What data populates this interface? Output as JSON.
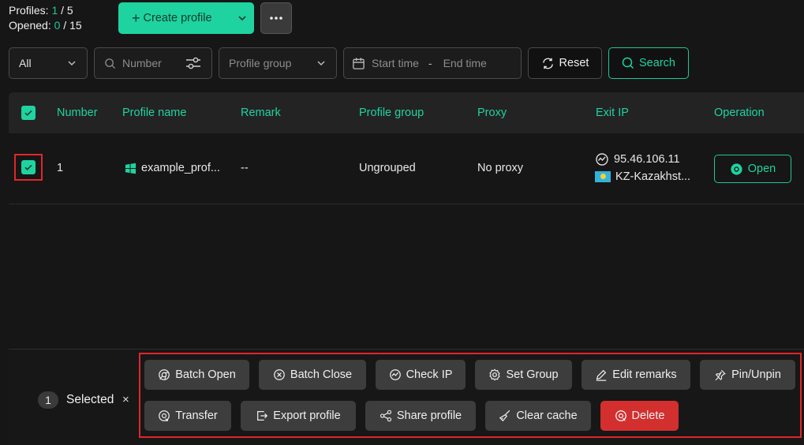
{
  "header": {
    "profiles_label": "Profiles:",
    "profiles_current": "1",
    "profiles_total": "/ 5",
    "opened_label": "Opened:",
    "opened_current": "0",
    "opened_total": "/ 15",
    "create_label": "Create profile"
  },
  "filters": {
    "all_value": "All",
    "number_placeholder": "Number",
    "group_placeholder": "Profile group",
    "start_time_placeholder": "Start time",
    "time_separator": "-",
    "end_time_placeholder": "End time",
    "reset_label": "Reset",
    "search_label": "Search"
  },
  "table": {
    "columns": [
      "Number",
      "Profile name",
      "Remark",
      "Profile group",
      "Proxy",
      "Exit IP",
      "Operation"
    ],
    "rows": [
      {
        "number": "1",
        "profile_name": "example_prof...",
        "remark": "--",
        "profile_group": "Ungrouped",
        "proxy": "No proxy",
        "exit_ip": "95.46.106.11",
        "exit_location": "KZ-Kazakhst...",
        "operation": "Open"
      }
    ]
  },
  "selection": {
    "count": "1",
    "label": "Selected",
    "clear_glyph": "×"
  },
  "actions": {
    "batch_open": "Batch Open",
    "batch_close": "Batch Close",
    "check_ip": "Check IP",
    "set_group": "Set Group",
    "edit_remarks": "Edit remarks",
    "pin_unpin": "Pin/Unpin",
    "transfer": "Transfer",
    "export_profile": "Export profile",
    "share_profile": "Share profile",
    "clear_cache": "Clear cache",
    "delete": "Delete"
  },
  "colors": {
    "accent": "#1fd3a0",
    "danger": "#d32f2f",
    "highlight_frame": "#e0262a",
    "background": "#161616"
  }
}
